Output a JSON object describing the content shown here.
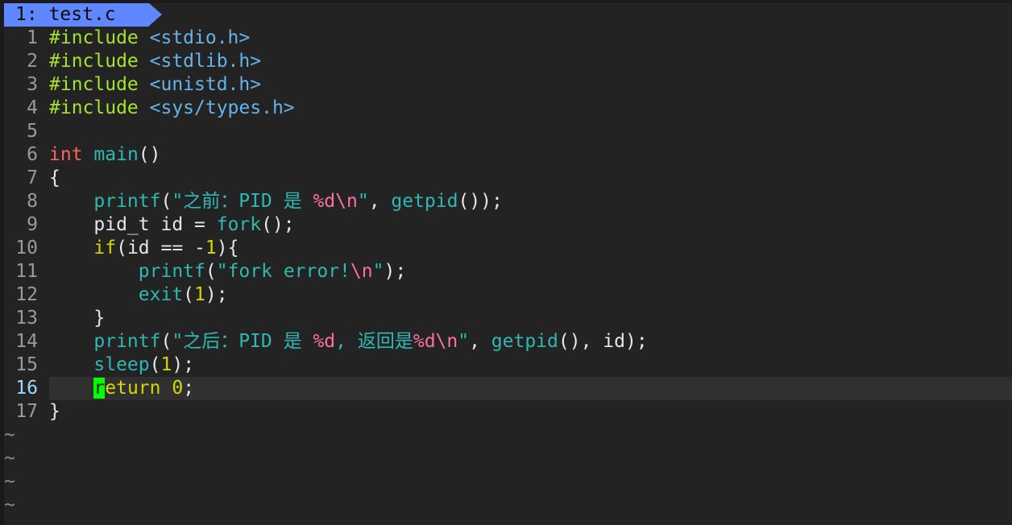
{
  "tab": {
    "index_label": "1:",
    "filename": "test.c",
    "accent_color": "#5f87ff"
  },
  "editor": {
    "current_line": 16,
    "cursor_char": "r",
    "cursor_color": "#00ff00",
    "tilde": "~"
  },
  "lines": [
    {
      "num": "1",
      "tokens": [
        {
          "c": "pre",
          "t": "#include "
        },
        {
          "c": "inc",
          "t": "<stdio.h>"
        }
      ]
    },
    {
      "num": "2",
      "tokens": [
        {
          "c": "pre",
          "t": "#include "
        },
        {
          "c": "inc",
          "t": "<stdlib.h>"
        }
      ]
    },
    {
      "num": "3",
      "tokens": [
        {
          "c": "pre",
          "t": "#include "
        },
        {
          "c": "inc",
          "t": "<unistd.h>"
        }
      ]
    },
    {
      "num": "4",
      "tokens": [
        {
          "c": "pre",
          "t": "#include "
        },
        {
          "c": "inc",
          "t": "<sys/types.h>"
        }
      ]
    },
    {
      "num": "5",
      "tokens": []
    },
    {
      "num": "6",
      "tokens": [
        {
          "c": "type",
          "t": "int"
        },
        {
          "c": "plain",
          "t": " "
        },
        {
          "c": "fn",
          "t": "main"
        },
        {
          "c": "plain",
          "t": "()"
        }
      ]
    },
    {
      "num": "7",
      "tokens": [
        {
          "c": "plain",
          "t": "{"
        }
      ]
    },
    {
      "num": "8",
      "tokens": [
        {
          "c": "plain",
          "t": "    "
        },
        {
          "c": "fn",
          "t": "printf"
        },
        {
          "c": "plain",
          "t": "("
        },
        {
          "c": "str",
          "t": "\"之前：PID 是 "
        },
        {
          "c": "esc",
          "t": "%d\\n"
        },
        {
          "c": "str",
          "t": "\""
        },
        {
          "c": "plain",
          "t": ", "
        },
        {
          "c": "fn",
          "t": "getpid"
        },
        {
          "c": "plain",
          "t": "());"
        }
      ]
    },
    {
      "num": "9",
      "tokens": [
        {
          "c": "plain",
          "t": "    pid_t id = "
        },
        {
          "c": "fn",
          "t": "fork"
        },
        {
          "c": "plain",
          "t": "();"
        }
      ]
    },
    {
      "num": "10",
      "tokens": [
        {
          "c": "plain",
          "t": "    "
        },
        {
          "c": "kw",
          "t": "if"
        },
        {
          "c": "plain",
          "t": "(id == -"
        },
        {
          "c": "num",
          "t": "1"
        },
        {
          "c": "plain",
          "t": "){"
        }
      ]
    },
    {
      "num": "11",
      "tokens": [
        {
          "c": "plain",
          "t": "        "
        },
        {
          "c": "fn",
          "t": "printf"
        },
        {
          "c": "plain",
          "t": "("
        },
        {
          "c": "str",
          "t": "\"fork error!"
        },
        {
          "c": "esc",
          "t": "\\n"
        },
        {
          "c": "str",
          "t": "\""
        },
        {
          "c": "plain",
          "t": ");"
        }
      ]
    },
    {
      "num": "12",
      "tokens": [
        {
          "c": "plain",
          "t": "        "
        },
        {
          "c": "fn",
          "t": "exit"
        },
        {
          "c": "plain",
          "t": "("
        },
        {
          "c": "num",
          "t": "1"
        },
        {
          "c": "plain",
          "t": ");"
        }
      ]
    },
    {
      "num": "13",
      "tokens": [
        {
          "c": "plain",
          "t": "    }"
        }
      ]
    },
    {
      "num": "14",
      "tokens": [
        {
          "c": "plain",
          "t": "    "
        },
        {
          "c": "fn",
          "t": "printf"
        },
        {
          "c": "plain",
          "t": "("
        },
        {
          "c": "str",
          "t": "\"之后：PID 是 "
        },
        {
          "c": "esc",
          "t": "%d"
        },
        {
          "c": "str",
          "t": ", 返回是"
        },
        {
          "c": "esc",
          "t": "%d\\n"
        },
        {
          "c": "str",
          "t": "\""
        },
        {
          "c": "plain",
          "t": ", "
        },
        {
          "c": "fn",
          "t": "getpid"
        },
        {
          "c": "plain",
          "t": "(), id);"
        }
      ]
    },
    {
      "num": "15",
      "tokens": [
        {
          "c": "plain",
          "t": "    "
        },
        {
          "c": "fn",
          "t": "sleep"
        },
        {
          "c": "plain",
          "t": "("
        },
        {
          "c": "num",
          "t": "1"
        },
        {
          "c": "plain",
          "t": ");"
        }
      ]
    },
    {
      "num": "16",
      "tokens": [
        {
          "c": "plain",
          "t": "    "
        },
        {
          "c": "cursor",
          "t": "r"
        },
        {
          "c": "kw",
          "t": "eturn"
        },
        {
          "c": "plain",
          "t": " "
        },
        {
          "c": "num",
          "t": "0"
        },
        {
          "c": "plain",
          "t": ";"
        }
      ]
    },
    {
      "num": "17",
      "tokens": [
        {
          "c": "plain",
          "t": "}"
        }
      ]
    }
  ],
  "tilde_count": 4
}
